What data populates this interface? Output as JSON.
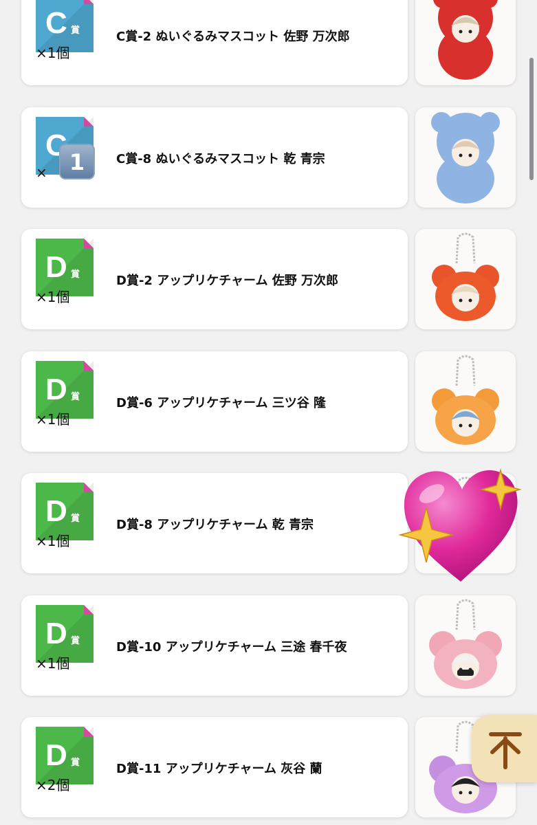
{
  "items": [
    {
      "badge_letter": "C",
      "badge_suffix": "賞",
      "badge_color": "#4ea8cf",
      "name": "C賞-2 ぬいぐるみマスコット 佐野 万次郎",
      "qty": "×1個",
      "thumb": "mascot-red-bear-icon"
    },
    {
      "badge_letter": "C",
      "badge_suffix": "賞",
      "badge_color": "#4ea8cf",
      "name": "C賞-8 ぬいぐるみマスコット 乾 青宗",
      "qty": "×",
      "qty_emoji": "1",
      "thumb": "mascot-blue-bear-icon"
    },
    {
      "badge_letter": "D",
      "badge_suffix": "賞",
      "badge_color": "#4cb84a",
      "name": "D賞-2 アップリケチャーム 佐野 万次郎",
      "qty": "×1個",
      "thumb": "charm-red-icon"
    },
    {
      "badge_letter": "D",
      "badge_suffix": "賞",
      "badge_color": "#4cb84a",
      "name": "D賞-6 アップリケチャーム 三ツ谷 隆",
      "qty": "×1個",
      "thumb": "charm-orange-icon"
    },
    {
      "badge_letter": "D",
      "badge_suffix": "賞",
      "badge_color": "#4cb84a",
      "name": "D賞-8 アップリケチャーム 乾 青宗",
      "qty": "×1個",
      "thumb": "charm-covered-icon"
    },
    {
      "badge_letter": "D",
      "badge_suffix": "賞",
      "badge_color": "#4cb84a",
      "name": "D賞-10 アップリケチャーム 三途 春千夜",
      "qty": "×1個",
      "thumb": "charm-pink-icon"
    },
    {
      "badge_letter": "D",
      "badge_suffix": "賞",
      "badge_color": "#4cb84a",
      "name": "D賞-11 アップリケチャーム 灰谷 蘭",
      "qty": "×2個",
      "thumb": "charm-purple-icon"
    }
  ],
  "overlays": {
    "heart": "sparkling-heart-icon",
    "back_to_top": "arrow-up-icon"
  },
  "colors": {
    "corner_fold": "#d44a9e",
    "heart": "#e0299a",
    "sparkle": "#f6c640",
    "to_top_bg": "#f3e2b8",
    "to_top_arrow": "#8a4a14"
  }
}
